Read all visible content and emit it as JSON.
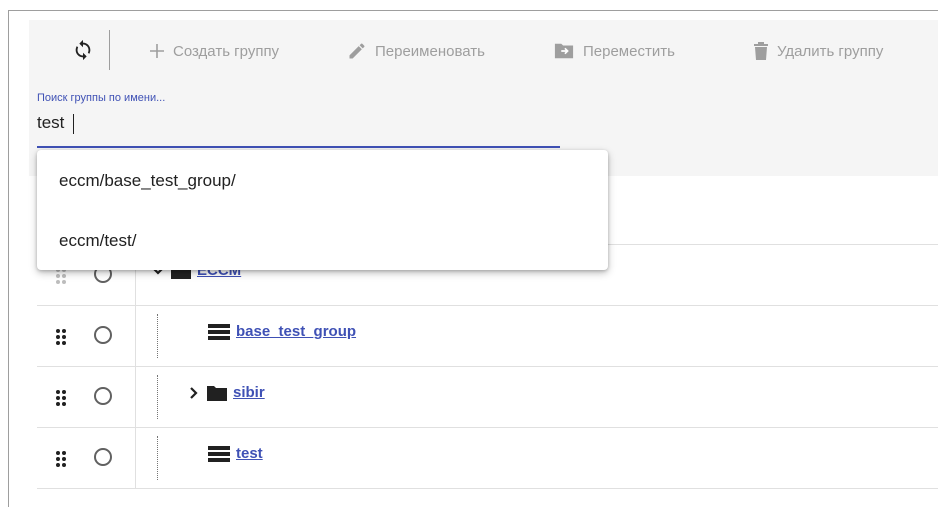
{
  "toolbar": {
    "refresh_icon": "refresh-icon",
    "create_group": "Создать группу",
    "rename": "Переименовать",
    "move": "Переместить",
    "delete_group": "Удалить группу",
    "disabled_color": "#9e9e9e"
  },
  "search": {
    "label": "Поиск группы по имени...",
    "value": "test",
    "accent": "#3f51b5"
  },
  "suggestions": [
    "eccm/base_test_group/",
    "eccm/test/"
  ],
  "tree": {
    "rows": [
      {
        "label": "ECCM",
        "type": "folder",
        "expanded": true
      },
      {
        "label": "base_test_group",
        "type": "group"
      },
      {
        "label": "sibir",
        "type": "folder",
        "expanded": false
      },
      {
        "label": "test",
        "type": "group"
      }
    ],
    "link_color": "#3f51b5"
  }
}
